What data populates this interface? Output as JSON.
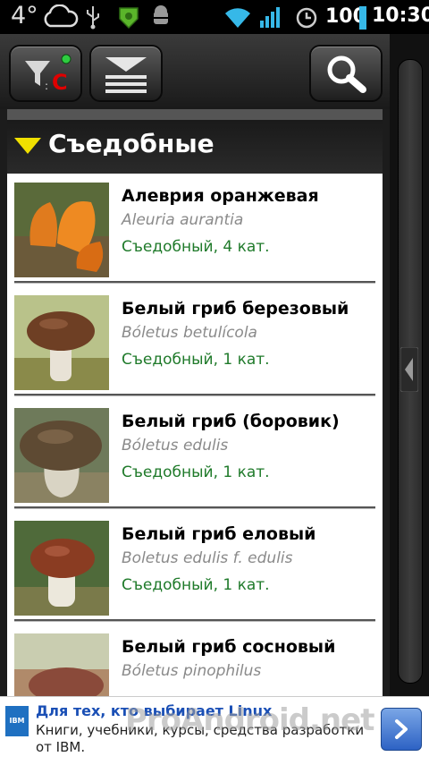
{
  "status_bar": {
    "temperature": "4°",
    "battery": "100",
    "time": "10:30",
    "icons": [
      "cloud-icon",
      "usb-icon",
      "app-shield-icon",
      "android-bug-icon",
      "wifi-icon",
      "signal-icon",
      "alarm-icon",
      "battery-icon"
    ]
  },
  "toolbar": {
    "filter_letter": "C",
    "buttons": [
      "filter-button",
      "sort-button",
      "search-button"
    ]
  },
  "section": {
    "title": "Съедобные"
  },
  "items": [
    {
      "name": "Алеврия оранжевая",
      "latin": "Aleuria aurantia",
      "category": "Съедобный, 4 кат.",
      "thumb_color": "#d9761e"
    },
    {
      "name": "Белый гриб березовый",
      "latin": "Bóletus betulícola",
      "category": "Съедобный, 1 кат.",
      "thumb_color": "#7a4a2c"
    },
    {
      "name": "Белый гриб (боровик)",
      "latin": "Bóletus edulis",
      "category": "Съедобный, 1 кат.",
      "thumb_color": "#6b4f33"
    },
    {
      "name": "Белый гриб еловый",
      "latin": "Boletus edulis f. edulis",
      "category": "Съедобный, 1 кат.",
      "thumb_color": "#8a3f24"
    },
    {
      "name": "Белый гриб сосновый",
      "latin": "Bóletus pinophilus",
      "category": "",
      "thumb_color": "#9a5a4a"
    }
  ],
  "ad": {
    "logo": "IBM",
    "title": "Для тех, кто выбирает Linux",
    "text": "Книги, учебники, курсы, средства разработки от IBM.",
    "watermark": "ProAndroid.net"
  },
  "colors": {
    "accent_yellow": "#f0e000",
    "category_green": "#1f7a2a",
    "filter_red": "#e00000",
    "filter_green_dot": "#2ecc40"
  }
}
